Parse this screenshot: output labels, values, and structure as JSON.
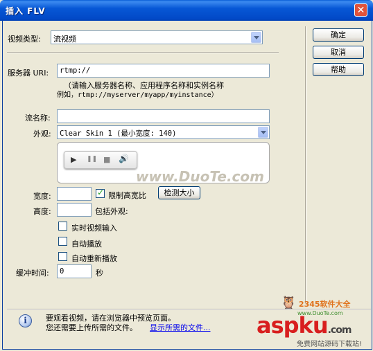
{
  "window": {
    "title": "插入 FLV",
    "close_glyph": "✕"
  },
  "video_type": {
    "label": "视频类型:",
    "value": "流视频"
  },
  "server_uri": {
    "label": "服务器 URI:",
    "value": "rtmp://",
    "hint_line1": "（请输入服务器名称、应用程序名称和实例名称",
    "hint_line2": "例如，rtmp://myserver/myapp/myinstance）"
  },
  "stream_name": {
    "label": "流名称:",
    "value": ""
  },
  "skin": {
    "label": "外观:",
    "value": "Clear Skin 1 (最小宽度: 140)"
  },
  "preview": {
    "controls": [
      "play-icon",
      "pause-icon",
      "stop-icon",
      "volume-icon"
    ],
    "glyphs": [
      "▶",
      "❚❚",
      "■",
      "🔊"
    ],
    "watermark": "www.DuoTe.com"
  },
  "width": {
    "label": "宽度:",
    "value": ""
  },
  "constrain": {
    "label": "限制高宽比",
    "checked": true
  },
  "detect_size": {
    "label": "检测大小"
  },
  "height": {
    "label": "高度:",
    "value": "",
    "suffix": "包括外观:"
  },
  "live_input": {
    "label": "实时视频输入",
    "checked": false
  },
  "autoplay": {
    "label": "自动播放",
    "checked": false
  },
  "autorewind": {
    "label": "自动重新播放",
    "checked": false
  },
  "buffer": {
    "label": "缓冲时间:",
    "value": "0",
    "unit": "秒"
  },
  "buttons": {
    "ok": "确定",
    "cancel": "取消",
    "help": "帮助"
  },
  "info": {
    "line1": "要观看视频，请在浏览器中预览页面。",
    "line2": "您还需要上传所需的文件。",
    "link": "显示所需的文件..."
  },
  "watermarks": {
    "site1": "2345软件大全",
    "site1_url": "www.DuoTe.com",
    "brand": "aspku",
    "brand_suffix": ".com",
    "slogan": "免费网站源码下载站!"
  }
}
